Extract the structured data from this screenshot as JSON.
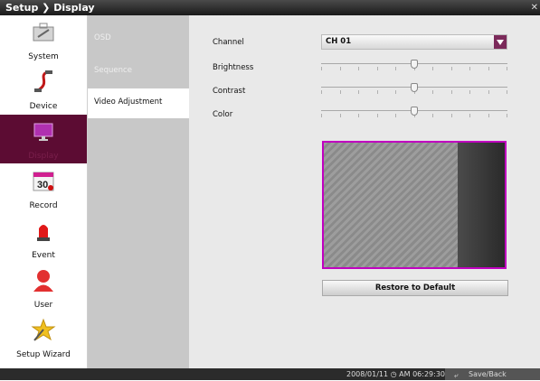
{
  "window": {
    "title": "Setup ❯ Display",
    "close_glyph": "✕"
  },
  "nav": [
    {
      "label": "System",
      "icon": "briefcase-icon"
    },
    {
      "label": "Device",
      "icon": "cable-icon"
    },
    {
      "label": "Display",
      "icon": "monitor-icon",
      "active": true
    },
    {
      "label": "Record",
      "icon": "calendar-icon"
    },
    {
      "label": "Event",
      "icon": "alarm-siren-icon"
    },
    {
      "label": "User",
      "icon": "user-icon"
    },
    {
      "label": "Setup Wizard",
      "icon": "wand-icon"
    }
  ],
  "submenu": [
    {
      "label": "OSD"
    },
    {
      "label": "Sequence"
    },
    {
      "label": "Video Adjustment",
      "active": true
    }
  ],
  "settings": {
    "channel_label": "Channel",
    "channel_value": "CH 01",
    "brightness_label": "Brightness",
    "contrast_label": "Contrast",
    "color_label": "Color",
    "brightness_level": 0.5,
    "contrast_level": 0.5,
    "color_level": 0.5
  },
  "restore_label": "Restore to Default",
  "status": {
    "datetime": "2008/01/11 ◷ AM 06:29:30",
    "save_back_label": "Save/Back"
  },
  "colors": {
    "accent": "#7b2a5a",
    "preview_border": "#c000c0",
    "active_nav": "#5c0c33"
  }
}
